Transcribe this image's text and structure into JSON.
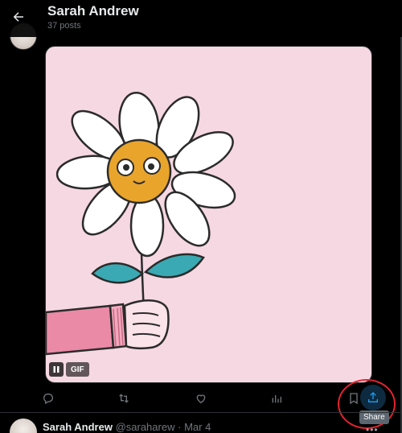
{
  "header": {
    "title": "Sarah Andrew",
    "post_count": "37 posts"
  },
  "media": {
    "gif_label": "GIF",
    "background": "#f6d8e2"
  },
  "actions": {
    "share_tooltip": "Share"
  },
  "next_post": {
    "name": "Sarah Andrew",
    "handle": "@saraharew",
    "separator": "·",
    "date": "Mar 4",
    "more": "•••"
  },
  "colors": {
    "accent": "#1d9bf0",
    "icon": "#71767b",
    "highlight_ring": "#e3232f"
  }
}
